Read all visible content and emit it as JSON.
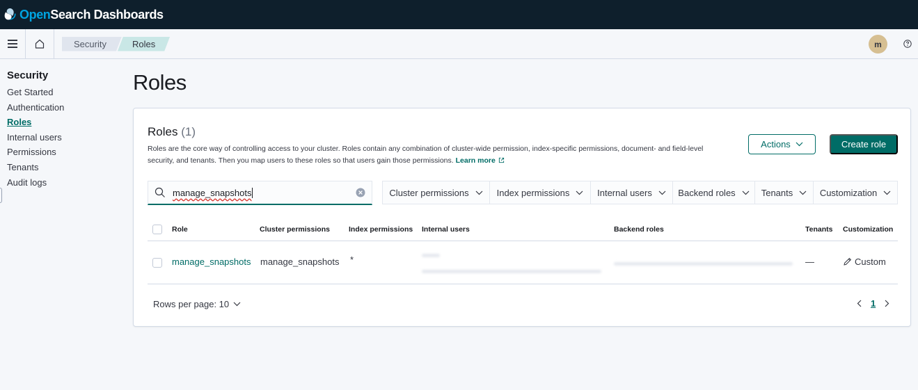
{
  "app": {
    "logo_open": "Open",
    "logo_rest": "Search Dashboards"
  },
  "breadcrumbs": [
    "Security",
    "Roles"
  ],
  "user": {
    "avatar_initial": "m"
  },
  "sidebar": {
    "title": "Security",
    "items": [
      {
        "label": "Get Started",
        "active": false
      },
      {
        "label": "Authentication",
        "active": false
      },
      {
        "label": "Roles",
        "active": true
      },
      {
        "label": "Internal users",
        "active": false
      },
      {
        "label": "Permissions",
        "active": false
      },
      {
        "label": "Tenants",
        "active": false
      },
      {
        "label": "Audit logs",
        "active": false
      }
    ]
  },
  "page": {
    "title": "Roles"
  },
  "panel": {
    "title": "Roles",
    "count": "(1)",
    "description_line1": "Roles are the core way of controlling access to your cluster. Roles contain any combination of cluster-wide permission, index-specific permissions, document- and field-level",
    "description_line2": "security, and tenants. Then you map users to these roles so that users gain those permissions.",
    "learn_more": "Learn more",
    "actions_label": "Actions",
    "create_label": "Create role"
  },
  "search": {
    "value": "manage_snapshots"
  },
  "filters": [
    "Cluster permissions",
    "Index permissions",
    "Internal users",
    "Backend roles",
    "Tenants",
    "Customization"
  ],
  "table": {
    "columns": [
      "Role",
      "Cluster permissions",
      "Index permissions",
      "Internal users",
      "Backend roles",
      "Tenants",
      "Customization"
    ],
    "rows": [
      {
        "role": "manage_snapshots",
        "cluster_permissions": "manage_snapshots",
        "index_permissions": "*",
        "tenants": "—",
        "customization": "Custom"
      }
    ]
  },
  "pagination": {
    "rows_per_page": "Rows per page: 10",
    "current_page": "1"
  },
  "colors": {
    "accent": "#006c66",
    "header_bg": "#0e1f2c",
    "logo_blue": "#00a3e0",
    "avatar": "#d6bf92"
  }
}
